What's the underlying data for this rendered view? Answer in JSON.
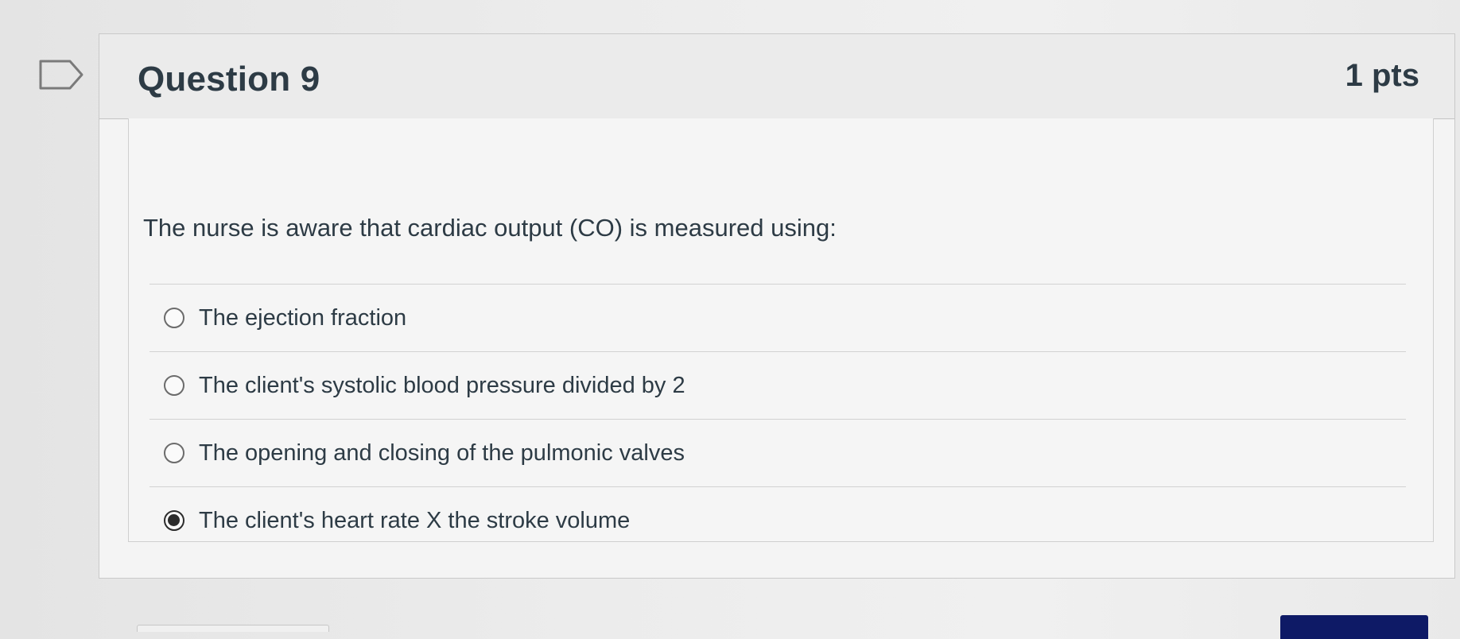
{
  "question": {
    "title": "Question 9",
    "points": "1 pts",
    "text": "The nurse is aware that cardiac output (CO) is measured using:",
    "flag_icon": "flag-icon"
  },
  "answers": [
    {
      "label": "The ejection fraction",
      "selected": false
    },
    {
      "label": "The client's systolic blood pressure divided by 2",
      "selected": false
    },
    {
      "label": "The opening and closing of the pulmonic valves",
      "selected": false
    },
    {
      "label": "The client's heart rate X the stroke volume",
      "selected": true
    }
  ],
  "colors": {
    "text": "#2d3b45",
    "primary_button": "#0e1a66"
  }
}
